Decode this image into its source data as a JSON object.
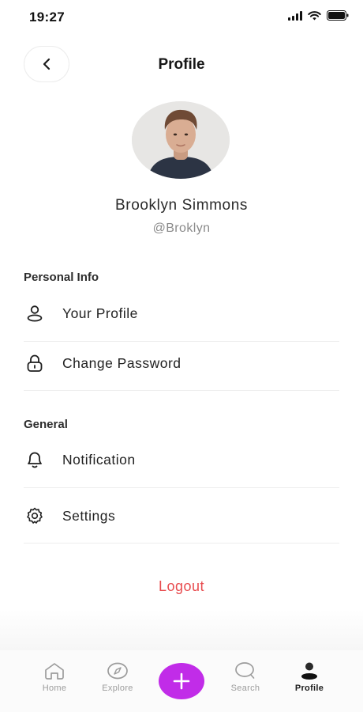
{
  "status_bar": {
    "time": "19:27"
  },
  "header": {
    "title": "Profile"
  },
  "profile": {
    "name": "Brooklyn Simmons",
    "handle": "@Broklyn"
  },
  "sections": {
    "personal": {
      "title": "Personal Info",
      "items": [
        {
          "label": "Your Profile",
          "icon": "user-icon"
        },
        {
          "label": "Change Password",
          "icon": "lock-icon"
        }
      ]
    },
    "general": {
      "title": "General",
      "items": [
        {
          "label": "Notification",
          "icon": "bell-icon"
        },
        {
          "label": "Settings",
          "icon": "gear-icon"
        }
      ]
    }
  },
  "logout_label": "Logout",
  "bottom_nav": {
    "items": [
      {
        "label": "Home",
        "icon": "home-icon"
      },
      {
        "label": "Explore",
        "icon": "compass-icon"
      },
      {
        "label": "Search",
        "icon": "search-icon"
      },
      {
        "label": "Profile",
        "icon": "profile-icon",
        "active": true
      }
    ],
    "fab_icon": "plus-icon"
  },
  "colors": {
    "accent": "#c12ce8",
    "logout": "#e84c4f",
    "muted": "#9c9c9c"
  }
}
